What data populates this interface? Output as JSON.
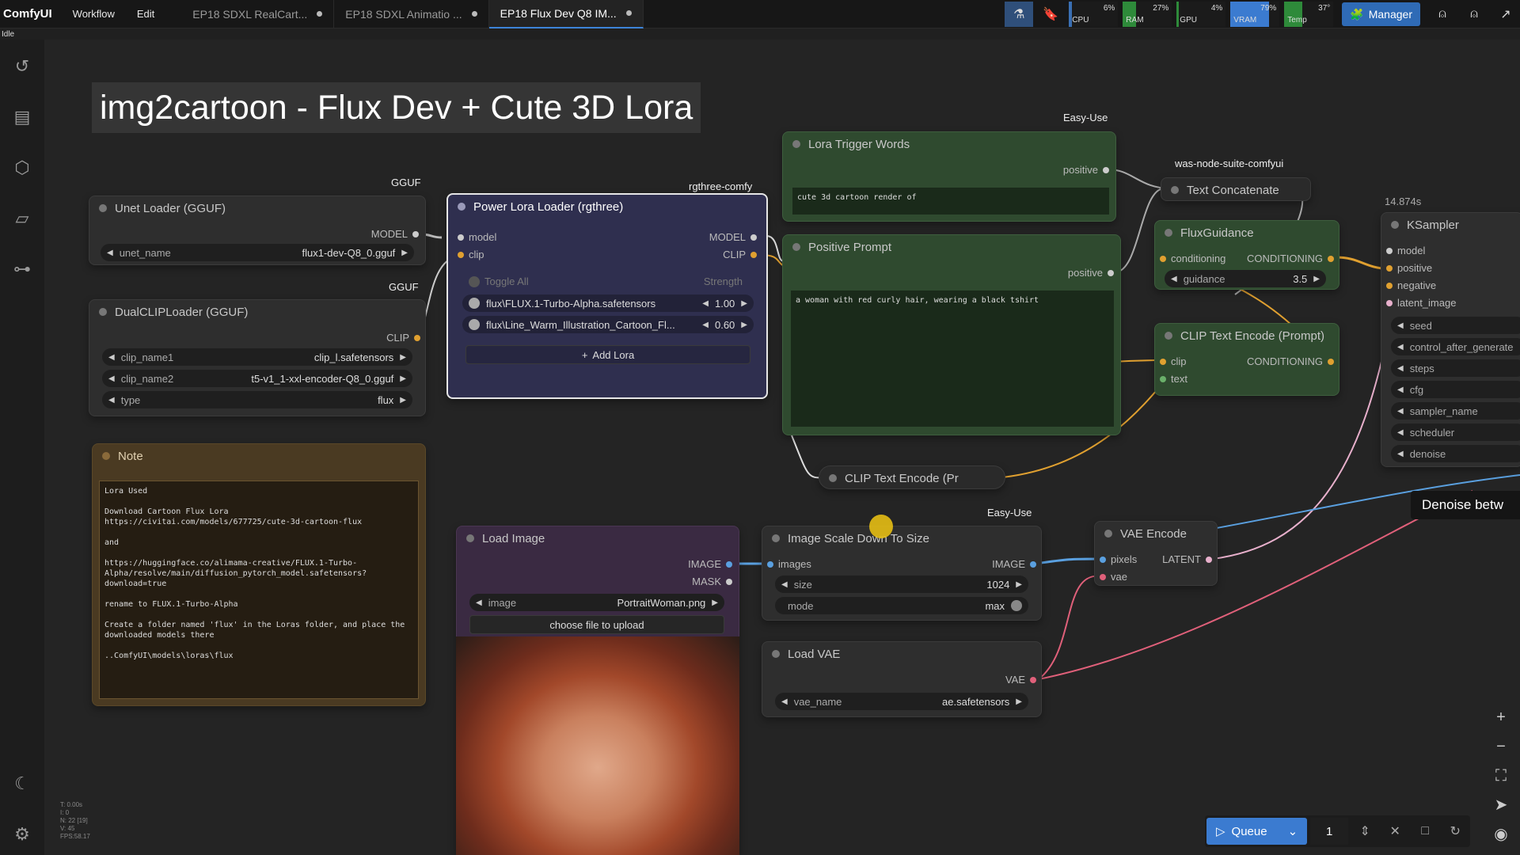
{
  "app": {
    "brand": "ComfyUI",
    "menu": [
      "Workflow",
      "Edit"
    ],
    "tabs": [
      {
        "label": "EP18 SDXL RealCart...",
        "active": false
      },
      {
        "label": "EP18 SDXL Animatio ...",
        "active": false
      },
      {
        "label": "EP18 Flux Dev Q8 IM...",
        "active": true
      }
    ],
    "status": "Idle",
    "meters": [
      {
        "label": "CPU",
        "pct": "6%",
        "color": "#3a6fb3",
        "value": 0.06
      },
      {
        "label": "RAM",
        "pct": "27%",
        "color": "#2e8a3a",
        "value": 0.27
      },
      {
        "label": "GPU",
        "pct": "4%",
        "color": "#2e8a3a",
        "value": 0.04
      },
      {
        "label": "VRAM",
        "pct": "79%",
        "color": "#3b7bd0",
        "value": 0.79
      },
      {
        "label": "Temp",
        "pct": "37°",
        "color": "#2e8a3a",
        "value": 0.37
      }
    ],
    "manager_label": "Manager"
  },
  "canvas": {
    "title": "img2cartoon - Flux Dev + Cute 3D Lora",
    "sources": {
      "ggufa": "GGUF",
      "ggufb": "GGUF",
      "rgthree": "rgthree-comfy",
      "easyuse1": "Easy-Use",
      "easyuse2": "Easy-Use",
      "was": "was-node-suite-comfyui",
      "timing": "14.874s"
    },
    "unet": {
      "title": "Unet Loader (GGUF)",
      "out": "MODEL",
      "w1_label": "unet_name",
      "w1_value": "flux1-dev-Q8_0.gguf"
    },
    "dualclip": {
      "title": "DualCLIPLoader (GGUF)",
      "out": "CLIP",
      "w1_label": "clip_name1",
      "w1_value": "clip_l.safetensors",
      "w2_label": "clip_name2",
      "w2_value": "t5-v1_1-xxl-encoder-Q8_0.gguf",
      "w3_label": "type",
      "w3_value": "flux"
    },
    "note": {
      "title": "Note",
      "text": "Lora Used\n\nDownload Cartoon Flux Lora\nhttps://civitai.com/models/677725/cute-3d-cartoon-flux\n\nand\n\nhttps://huggingface.co/alimama-creative/FLUX.1-Turbo-Alpha/resolve/main/diffusion_pytorch_model.safetensors?download=true\n\nrename to FLUX.1-Turbo-Alpha\n\nCreate a folder named 'flux' in the Loras folder, and place the downloaded models there\n\n..ComfyUI\\models\\loras\\flux"
    },
    "powerlora": {
      "title": "Power Lora Loader (rgthree)",
      "in1": "model",
      "in2": "clip",
      "out1": "MODEL",
      "out2": "CLIP",
      "toggle_all": "Toggle All",
      "strength": "Strength",
      "lora1": "flux\\FLUX.1-Turbo-Alpha.safetensors",
      "lora1_val": "1.00",
      "lora2": "flux\\Line_Warm_Illustration_Cartoon_Fl...",
      "lora2_val": "0.60",
      "add": "Add Lora"
    },
    "trigger": {
      "title": "Lora Trigger Words",
      "out": "positive",
      "text": "cute 3d cartoon render of"
    },
    "positive": {
      "title": "Positive Prompt",
      "out": "positive",
      "text": "a woman with red curly hair, wearing a black tshirt"
    },
    "textconcat": {
      "title": "Text Concatenate"
    },
    "fluxguidance": {
      "title": "FluxGuidance",
      "in1": "conditioning",
      "out1": "CONDITIONING",
      "w1_label": "guidance",
      "w1_value": "3.5"
    },
    "clipenc": {
      "title": "CLIP Text Encode (Prompt)",
      "in1": "clip",
      "in2": "text",
      "out1": "CONDITIONING"
    },
    "clipenc2": {
      "title": "CLIP Text Encode (Pr"
    },
    "ksampler": {
      "title": "KSampler",
      "ins": [
        "model",
        "positive",
        "negative",
        "latent_image"
      ],
      "widgets": [
        "seed",
        "control_after_generate",
        "steps",
        "cfg",
        "sampler_name",
        "scheduler",
        "denoise"
      ]
    },
    "loadimage": {
      "title": "Load Image",
      "out1": "IMAGE",
      "out2": "MASK",
      "w1_label": "image",
      "w1_value": "PortraitWoman.png",
      "upload": "choose file to upload"
    },
    "scale": {
      "title": "Image Scale Down To Size",
      "in1": "images",
      "out1": "IMAGE",
      "w1_label": "size",
      "w1_value": "1024",
      "w2_label": "mode",
      "w2_value": "max"
    },
    "vaeenc": {
      "title": "VAE Encode",
      "in1": "pixels",
      "in2": "vae",
      "out1": "LATENT"
    },
    "loadvae": {
      "title": "Load VAE",
      "out1": "VAE",
      "w1_label": "vae_name",
      "w1_value": "ae.safetensors"
    },
    "tooltip": "Denoise betw",
    "stats": "T: 0.00s\nI: 0\nN: 22 [19]\nV: 45\nFPS:58.17"
  },
  "queue": {
    "label": "Queue",
    "count": "1"
  },
  "icons": {
    "sidebar": [
      "history-icon",
      "queue-list-icon",
      "model-library-icon",
      "workflows-folder-icon",
      "node-library-icon",
      "theme-moon-icon",
      "settings-gear-icon"
    ]
  }
}
